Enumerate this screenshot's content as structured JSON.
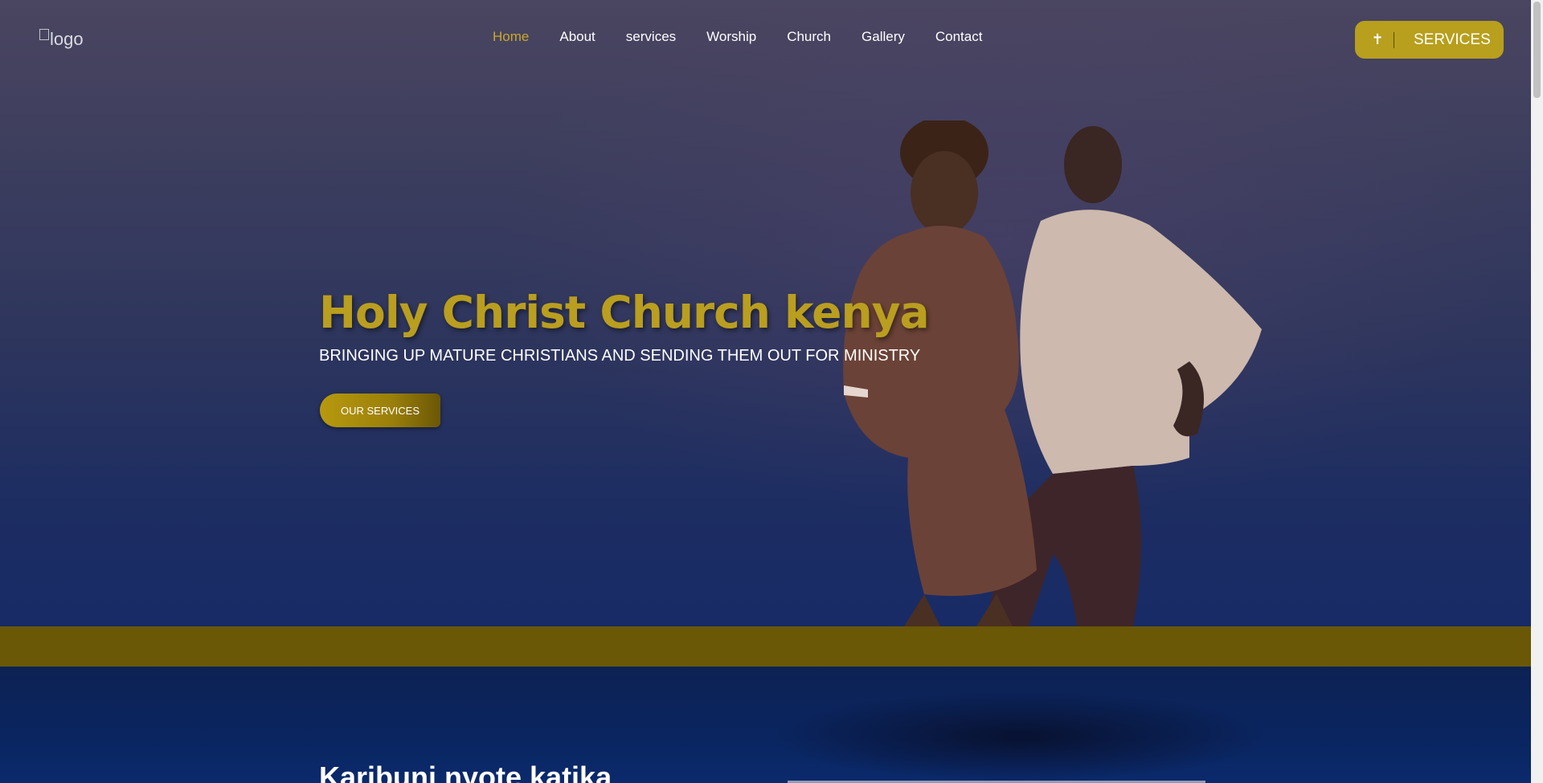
{
  "header": {
    "logo_alt": "logo",
    "nav": [
      {
        "label": "Home",
        "active": true
      },
      {
        "label": "About"
      },
      {
        "label": "services"
      },
      {
        "label": "Worship"
      },
      {
        "label": "Church"
      },
      {
        "label": "Gallery"
      },
      {
        "label": "Contact"
      }
    ],
    "services_button": {
      "icon": "cross-icon",
      "glyph": "✝",
      "label": "SERVICES"
    }
  },
  "hero": {
    "title": "Holy Christ Church kenya",
    "subtitle": "BRINGING UP MATURE CHRISTIANS AND SENDING THEM OUT FOR MINISTRY",
    "button_label": "OUR SERVICES"
  },
  "section2": {
    "title": "Karibuni nyote katika"
  },
  "colors": {
    "accent_gold": "#b99e1f",
    "band_gold": "#6a5806",
    "navy": "#0d2155"
  }
}
